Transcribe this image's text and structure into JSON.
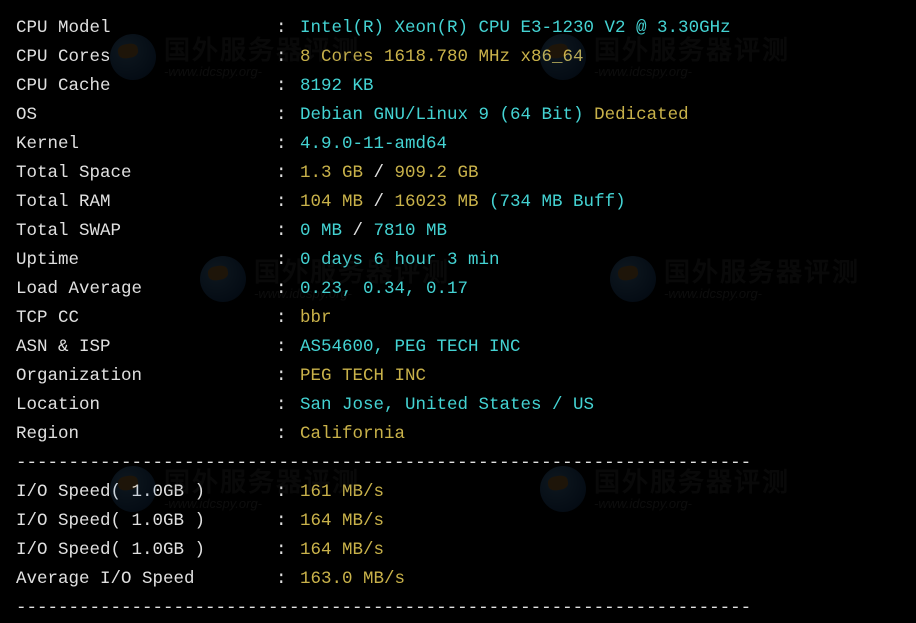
{
  "divider": "----------------------------------------------------------------------",
  "rows": [
    {
      "label": "CPU Model",
      "parts": [
        {
          "text": "Intel(R) Xeon(R) CPU E3-1230 V2 @ 3.30GHz",
          "cls": "cyan"
        }
      ]
    },
    {
      "label": "CPU Cores",
      "parts": [
        {
          "text": "8 Cores 1618.780 MHz x86_64",
          "cls": "yellow"
        }
      ]
    },
    {
      "label": "CPU Cache",
      "parts": [
        {
          "text": "8192 KB",
          "cls": "cyan"
        }
      ]
    },
    {
      "label": "OS",
      "parts": [
        {
          "text": "Debian GNU/Linux 9 (64 Bit) ",
          "cls": "cyan"
        },
        {
          "text": "Dedicated",
          "cls": "yellow"
        }
      ]
    },
    {
      "label": "Kernel",
      "parts": [
        {
          "text": "4.9.0-11-amd64",
          "cls": "cyan"
        }
      ]
    },
    {
      "label": "Total Space",
      "parts": [
        {
          "text": "1.3 GB ",
          "cls": "yellow"
        },
        {
          "text": "/ ",
          "cls": "white"
        },
        {
          "text": "909.2 GB",
          "cls": "yellow"
        }
      ]
    },
    {
      "label": "Total RAM",
      "parts": [
        {
          "text": "104 MB ",
          "cls": "yellow"
        },
        {
          "text": "/ ",
          "cls": "white"
        },
        {
          "text": "16023 MB ",
          "cls": "yellow"
        },
        {
          "text": "(734 MB Buff)",
          "cls": "cyan"
        }
      ]
    },
    {
      "label": "Total SWAP",
      "parts": [
        {
          "text": "0 MB ",
          "cls": "cyan"
        },
        {
          "text": "/ ",
          "cls": "white"
        },
        {
          "text": "7810 MB",
          "cls": "cyan"
        }
      ]
    },
    {
      "label": "Uptime",
      "parts": [
        {
          "text": "0 days 6 hour 3 min",
          "cls": "cyan"
        }
      ]
    },
    {
      "label": "Load Average",
      "parts": [
        {
          "text": "0.23, 0.34, 0.17",
          "cls": "cyan"
        }
      ]
    },
    {
      "label": "TCP CC",
      "parts": [
        {
          "text": "bbr",
          "cls": "yellow"
        }
      ]
    },
    {
      "label": "ASN & ISP",
      "parts": [
        {
          "text": "AS54600, PEG TECH INC",
          "cls": "cyan"
        }
      ]
    },
    {
      "label": "Organization",
      "parts": [
        {
          "text": "PEG TECH INC",
          "cls": "yellow"
        }
      ]
    },
    {
      "label": "Location",
      "parts": [
        {
          "text": "San Jose, United States / US",
          "cls": "cyan"
        }
      ]
    },
    {
      "label": "Region",
      "parts": [
        {
          "text": "California",
          "cls": "yellow"
        }
      ]
    }
  ],
  "io_rows": [
    {
      "label": "I/O Speed( 1.0GB )",
      "parts": [
        {
          "text": "161 MB/s",
          "cls": "yellow"
        }
      ]
    },
    {
      "label": "I/O Speed( 1.0GB )",
      "parts": [
        {
          "text": "164 MB/s",
          "cls": "yellow"
        }
      ]
    },
    {
      "label": "I/O Speed( 1.0GB )",
      "parts": [
        {
          "text": "164 MB/s",
          "cls": "yellow"
        }
      ]
    },
    {
      "label": "Average I/O Speed",
      "parts": [
        {
          "text": "163.0 MB/s",
          "cls": "yellow"
        }
      ]
    }
  ],
  "watermark": {
    "cn": "国外服务器评测",
    "url": "-www.idcspy.org-"
  }
}
